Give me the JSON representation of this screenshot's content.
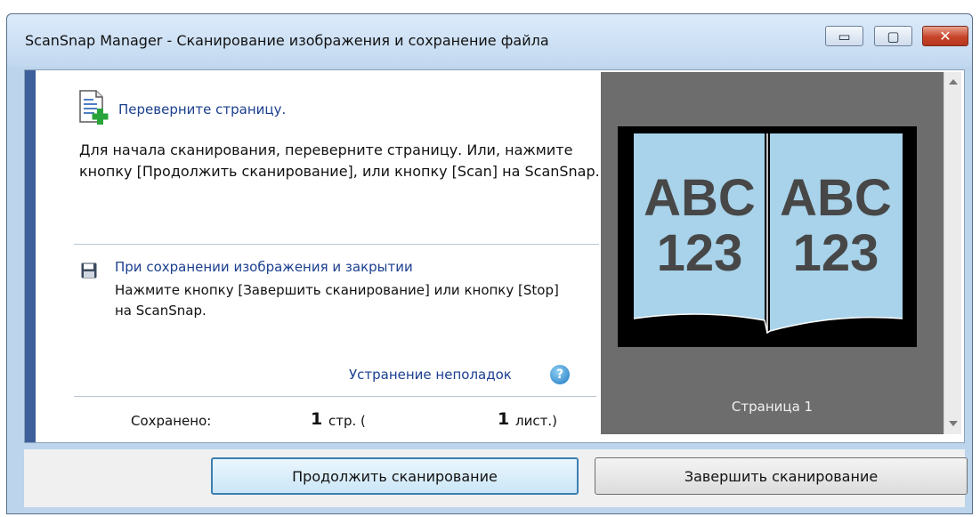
{
  "window": {
    "title": "ScanSnap Manager - Сканирование изображения и сохранение файла",
    "controls": {
      "minimize": "▭",
      "maximize": "▢",
      "close": "✕"
    }
  },
  "header": {
    "icon": "page-add-icon",
    "title": "Переверните страницу.",
    "text": "Для начала сканирования, переверните страницу. Или, нажмите кнопку [Продолжить сканирование], или кнопку [Scan] на ScanSnap."
  },
  "save_section": {
    "icon": "floppy-disk-icon",
    "title": "При сохранении изображения и закрытии",
    "text": "Нажмите кнопку [Завершить сканирование] или кнопку [Stop] на ScanSnap."
  },
  "troubleshoot": {
    "label": "Устранение неполадок",
    "icon": "help-icon",
    "icon_glyph": "?"
  },
  "saved": {
    "label": "Сохранено:",
    "pages_count": "1",
    "pages_unit": "стр. (",
    "sheets_count": "1",
    "sheets_unit": "лист.)"
  },
  "preview": {
    "left_text_line1": "ABC",
    "left_text_line2": "123",
    "right_text_line1": "ABC",
    "right_text_line2": "123",
    "page_label": "Страница 1"
  },
  "buttons": {
    "continue": "Продолжить сканирование",
    "finish": "Завершить сканирование"
  }
}
